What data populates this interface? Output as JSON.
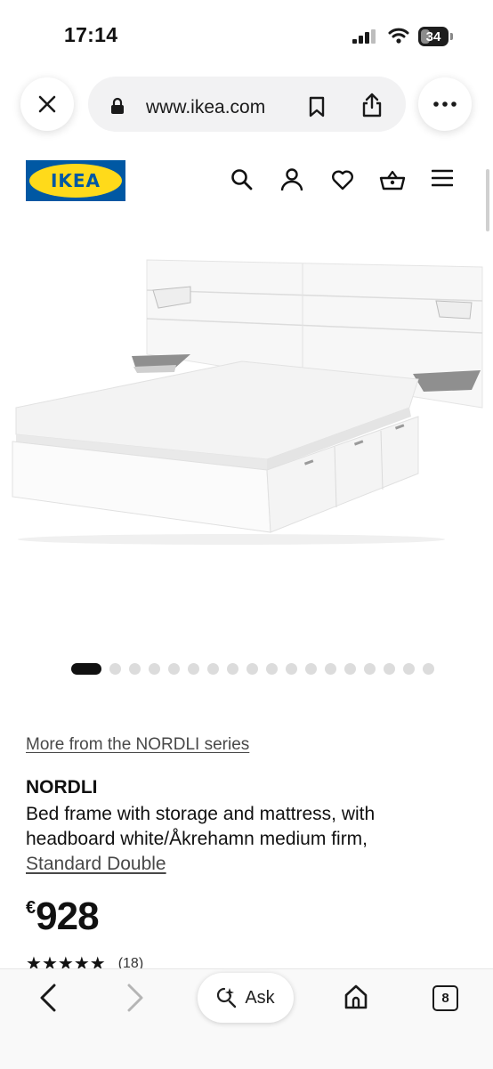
{
  "status_bar": {
    "time": "17:14",
    "battery": "34"
  },
  "browser": {
    "url": "www.ikea.com"
  },
  "header": {
    "logo_text": "IKEA"
  },
  "carousel": {
    "total": 18,
    "active": 0
  },
  "product": {
    "series_link": "More from the NORDLI series",
    "name": "NORDLI",
    "description": "Bed frame with storage and mattress, with headboard white/Åkrehamn medium firm,",
    "size": "Standard Double",
    "currency": "€",
    "price": "928",
    "rating": 5,
    "review_count": "(18)"
  },
  "toolbar": {
    "ask_label": "Ask",
    "tab_count": "8"
  },
  "colors": {
    "ikea_blue": "#0058a3",
    "ikea_yellow": "#ffda1a"
  }
}
